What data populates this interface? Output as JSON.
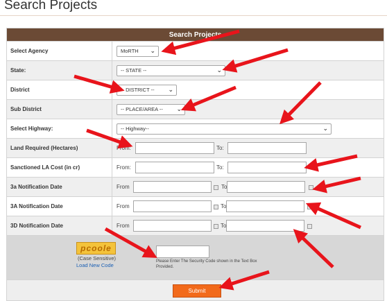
{
  "page": {
    "title": "Search Projects"
  },
  "form": {
    "header": "Search Projects",
    "rows": {
      "agency": {
        "label": "Select Agency",
        "value": "MoRTH"
      },
      "state": {
        "label": "State:",
        "value": "-- STATE --"
      },
      "district": {
        "label": "District",
        "value": "-- DISTRICT --"
      },
      "sub_district": {
        "label": "Sub District",
        "value": "-- PLACE/AREA --"
      },
      "highway": {
        "label": "Select Highway:",
        "value": "-- Highway--"
      },
      "land": {
        "label": "Land Required (Hectares)",
        "from": "From:",
        "to": "To:"
      },
      "la_cost": {
        "label": "Sanctioned LA Cost (in cr)",
        "from": "From:",
        "to": "To:"
      },
      "notif_3a": {
        "label": "3a Notification Date",
        "from": "From",
        "to": "To"
      },
      "notif_3A": {
        "label": "3A Notification Date",
        "from": "From",
        "to": "To"
      },
      "notif_3D": {
        "label": "3D Notification Date",
        "from": "From",
        "to": "To"
      }
    },
    "captcha": {
      "image_text": "pcoole",
      "case_note": "(Case Sensitive)",
      "reload_link": "Load New Code",
      "help": "Please Enter The Security Code shown in the Text Box Provided."
    },
    "submit_label": "Submit"
  },
  "colors": {
    "header": "#6b4a35",
    "submit": "#f26a1b",
    "arrows": "#e8141b"
  },
  "icons": {
    "dropdown": "chevron-down-icon",
    "date": "calendar-icon"
  }
}
